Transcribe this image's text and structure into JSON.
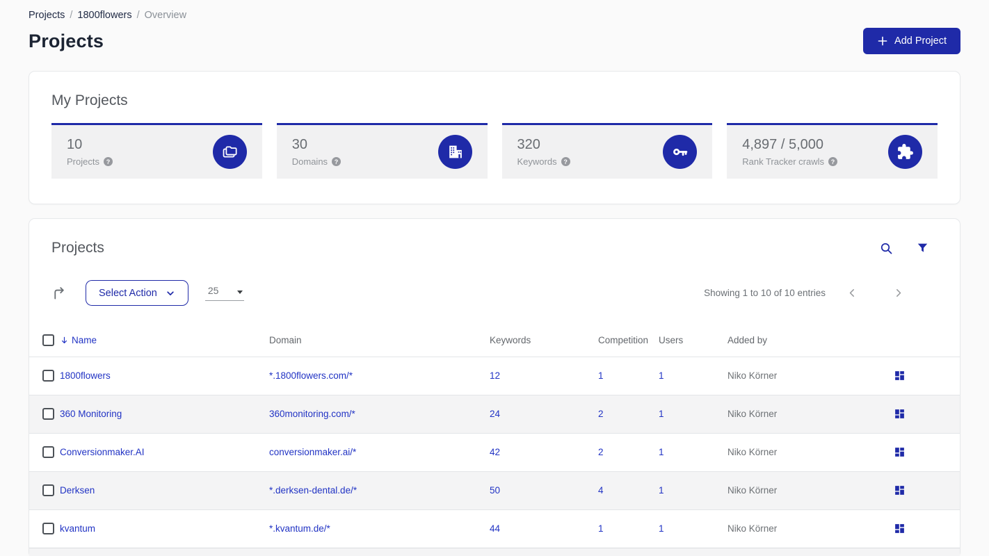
{
  "colors": {
    "brand_blue": "#1f2aa8",
    "link_blue": "#2133c4"
  },
  "breadcrumb": {
    "separator": "/",
    "items": [
      {
        "label": "Projects"
      },
      {
        "label": "1800flowers"
      },
      {
        "label": "Overview"
      }
    ]
  },
  "page": {
    "title": "Projects",
    "add_project_label": "Add Project"
  },
  "my_projects": {
    "title": "My Projects",
    "stats": [
      {
        "value": "10",
        "label": "Projects",
        "icon": "projects-stack-icon"
      },
      {
        "value": "30",
        "label": "Domains",
        "icon": "building-icon"
      },
      {
        "value": "320",
        "label": "Keywords",
        "icon": "key-icon"
      },
      {
        "value": "4,897 / 5,000",
        "label": "Rank Tracker crawls",
        "icon": "puzzle-icon"
      }
    ]
  },
  "projects_table": {
    "title": "Projects",
    "toolbar": {
      "select_action_label": "Select Action",
      "page_size": "25",
      "showing_text": "Showing 1 to 10 of 10 entries"
    },
    "columns": [
      "Name",
      "Domain",
      "Keywords",
      "Competition",
      "Users",
      "Added by"
    ],
    "rows": [
      {
        "name": "1800flowers",
        "domain": "*.1800flowers.com/*",
        "keywords": "12",
        "competition": "1",
        "users": "1",
        "added_by": "Niko Körner"
      },
      {
        "name": "360 Monitoring",
        "domain": "360monitoring.com/*",
        "keywords": "24",
        "competition": "2",
        "users": "1",
        "added_by": "Niko Körner"
      },
      {
        "name": "Conversionmaker.AI",
        "domain": "conversionmaker.ai/*",
        "keywords": "42",
        "competition": "2",
        "users": "1",
        "added_by": "Niko Körner"
      },
      {
        "name": "Derksen",
        "domain": "*.derksen-dental.de/*",
        "keywords": "50",
        "competition": "4",
        "users": "1",
        "added_by": "Niko Körner"
      },
      {
        "name": "kvantum",
        "domain": "*.kvantum.de/*",
        "keywords": "44",
        "competition": "1",
        "users": "1",
        "added_by": "Niko Körner"
      }
    ]
  }
}
